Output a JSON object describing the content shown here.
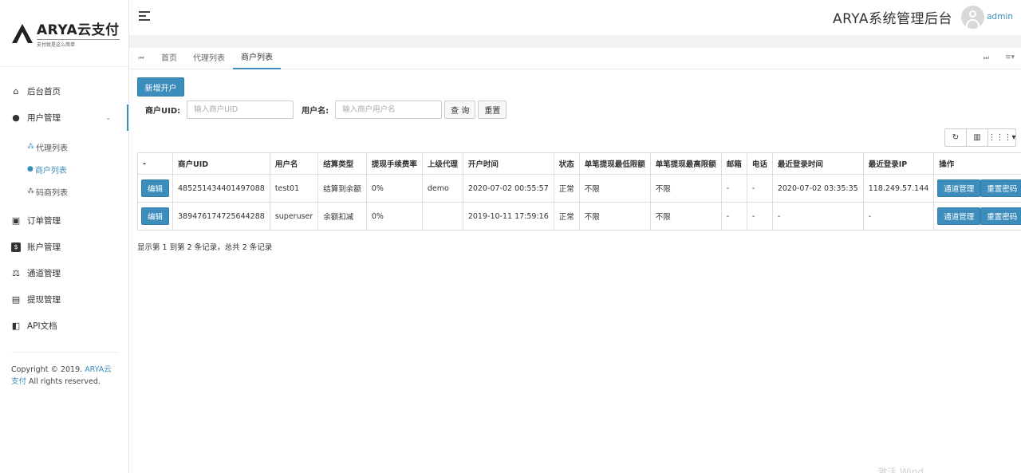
{
  "logo": {
    "title": "ARYA云支付",
    "subtitle": "支付就是这么简单"
  },
  "sidebar": {
    "items": [
      {
        "icon": "home-icon",
        "label": "后台首页"
      },
      {
        "icon": "user-icon",
        "label": "用户管理"
      },
      {
        "icon": "order-icon",
        "label": "订单管理"
      },
      {
        "icon": "account-icon",
        "label": "账户管理"
      },
      {
        "icon": "channel-icon",
        "label": "通道管理"
      },
      {
        "icon": "withdraw-icon",
        "label": "提现管理"
      },
      {
        "icon": "api-doc-icon",
        "label": "API文档"
      }
    ],
    "subitems": [
      {
        "label": "代理列表"
      },
      {
        "label": "商户列表"
      },
      {
        "label": "码商列表"
      }
    ],
    "copyright_prefix": "Copyright © 2019. ",
    "copyright_brand": "ARYA云支付",
    "copyright_suffix": " All rights reserved."
  },
  "header": {
    "system_title": "ARYA系统管理后台",
    "user": "admin"
  },
  "tabs": [
    {
      "label": "首页"
    },
    {
      "label": "代理列表"
    },
    {
      "label": "商户列表"
    }
  ],
  "toolbar": {
    "add_label": "新增开户",
    "uid_label": "商户UID:",
    "uid_placeholder": "输入商户UID",
    "name_label": "用户名:",
    "name_placeholder": "输入商户用户名",
    "query_label": "查 询",
    "reset_label": "重置"
  },
  "table": {
    "headers": [
      "-",
      "商户UID",
      "用户名",
      "结算类型",
      "提现手续费率",
      "上级代理",
      "开户时间",
      "状态",
      "单笔提现最低限额",
      "单笔提现最高限额",
      "邮箱",
      "电话",
      "最近登录时间",
      "最近登录IP",
      "操作"
    ],
    "edit_label": "编辑",
    "channel_label": "通道管理",
    "reset_pwd_label": "重置密码",
    "rows": [
      {
        "uid": "485251434401497088",
        "username": "test01",
        "settle": "结算到余额",
        "fee": "0%",
        "agent": "demo",
        "open_time": "2020-07-02 00:55:57",
        "status": "正常",
        "min": "不限",
        "max": "不限",
        "email": "-",
        "phone": "-",
        "last_login": "2020-07-02 03:35:35",
        "ip": "118.249.57.144"
      },
      {
        "uid": "389476174725644288",
        "username": "superuser",
        "settle": "余额扣减",
        "fee": "0%",
        "agent": "",
        "open_time": "2019-10-11 17:59:16",
        "status": "正常",
        "min": "不限",
        "max": "不限",
        "email": "-",
        "phone": "-",
        "last_login": "-",
        "ip": "-"
      }
    ]
  },
  "summary": "显示第 1 到第 2 条记录，总共 2 条记录",
  "watermark": "激活 Wind"
}
